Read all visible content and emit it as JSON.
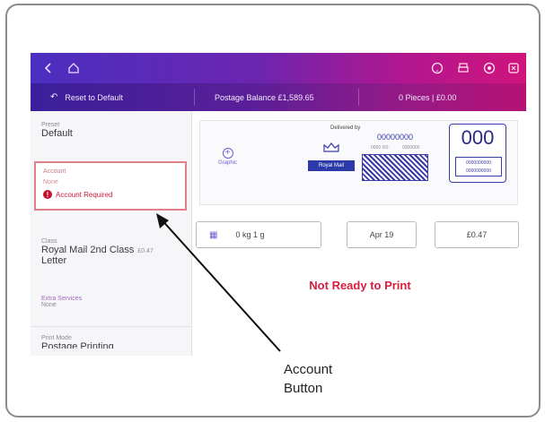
{
  "topbar": {
    "icons": [
      "back-icon",
      "home-icon",
      "help-icon",
      "print-icon",
      "settings-icon",
      "close-icon"
    ]
  },
  "subbar": {
    "reset_label": "Reset to Default",
    "postage_balance": "Postage Balance £1,589.65",
    "pieces": "0 Pieces | £0.00"
  },
  "sidebar": {
    "preset_label": "Preset",
    "preset_value": "Default",
    "account_label": "Account",
    "account_value": "None",
    "account_required": "Account Required",
    "class_label": "Class",
    "class_value": "Royal Mail 2nd Class",
    "class_price": "£0.47",
    "class_sub": "Letter",
    "extra_label": "Extra Services",
    "extra_value": "None",
    "print_mode_label": "Print Mode",
    "print_mode_value": "Postage Printing"
  },
  "indicia": {
    "graphic_label": "Graphic",
    "delivered_by": "Delivered by",
    "serial": "00000000",
    "small1": "0000 0/0",
    "small2": "0000000",
    "postmark": "000",
    "royal_mail": "Royal Mail",
    "postmark_small": "0000000000"
  },
  "fields": {
    "weight": "0 kg 1 g",
    "date": "Apr 19",
    "amount": "£0.47"
  },
  "status": "Not Ready to Print",
  "callout": {
    "line1": "Account",
    "line2": "Button"
  },
  "colors": {
    "accent": "#5a1f98",
    "brand_magenta": "#d0147c",
    "error": "#d81e3c"
  }
}
